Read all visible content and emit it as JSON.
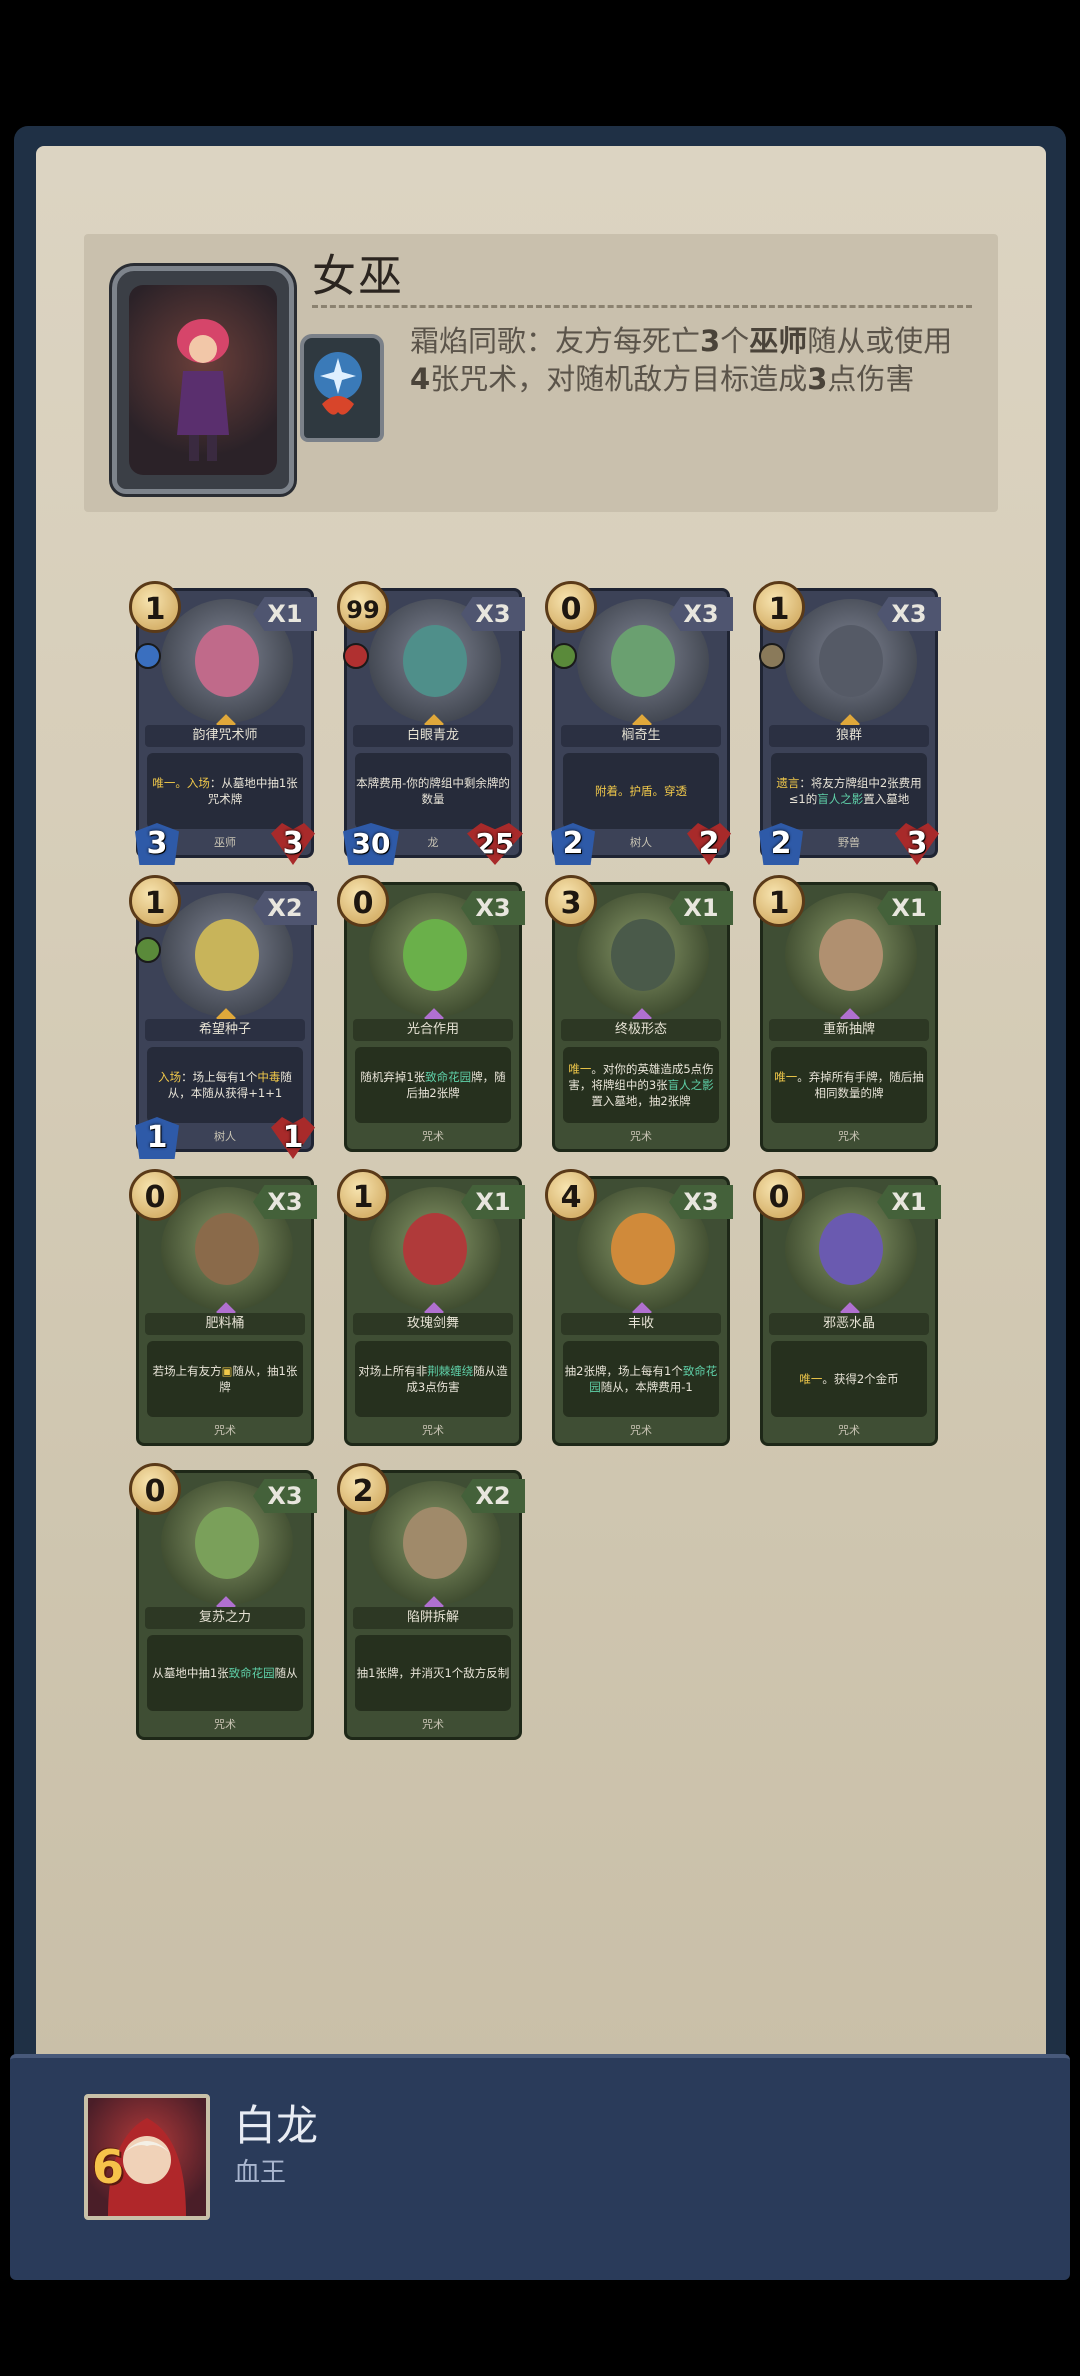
{
  "hero": {
    "name": "女巫",
    "skill_parts": [
      {
        "t": "霜焰同歌：友方每死亡",
        "b": false
      },
      {
        "t": "3",
        "b": true
      },
      {
        "t": "个",
        "b": false
      },
      {
        "t": "巫师",
        "b": true
      },
      {
        "t": "随从或使用",
        "b": false
      },
      {
        "t": "4",
        "b": true
      },
      {
        "t": "张咒术，对随机敌方目标造成",
        "b": false
      },
      {
        "t": "3",
        "b": true
      },
      {
        "t": "点伤害",
        "b": false
      }
    ]
  },
  "cards": [
    {
      "kind": "minion",
      "cost": "1",
      "count": "X1",
      "name": "韵律咒术师",
      "desc": [
        {
          "t": "唯一。",
          "c": "y"
        },
        {
          "t": "入场",
          "c": "y"
        },
        {
          "t": "：从墓地中抽1张咒术牌"
        }
      ],
      "race": "巫师",
      "atk": "3",
      "hp": "3",
      "tribe": "#3a6fbf"
    },
    {
      "kind": "minion",
      "cost": "99",
      "count": "X3",
      "name": "白眼青龙",
      "desc": [
        {
          "t": "本牌费用-你的牌组中剩余牌的数量"
        }
      ],
      "race": "龙",
      "atk": "30",
      "hp": "25",
      "tribe": "#b03030"
    },
    {
      "kind": "minion",
      "cost": "0",
      "count": "X3",
      "name": "榈奇生",
      "desc": [
        {
          "t": "附着。护盾。穿透",
          "c": "y"
        }
      ],
      "race": "树人",
      "atk": "2",
      "hp": "2",
      "tribe": "#5a8a3a"
    },
    {
      "kind": "minion",
      "cost": "1",
      "count": "X3",
      "name": "狼群",
      "desc": [
        {
          "t": "遗言",
          "c": "y"
        },
        {
          "t": "：将友方牌组中2张费用≤1的"
        },
        {
          "t": "盲人之影",
          "c": "g"
        },
        {
          "t": "置入墓地"
        }
      ],
      "race": "野兽",
      "atk": "2",
      "hp": "3",
      "tribe": "#8a7a5a"
    },
    {
      "kind": "minion",
      "cost": "1",
      "count": "X2",
      "name": "希望种子",
      "desc": [
        {
          "t": "入场",
          "c": "y"
        },
        {
          "t": "：场上每有1个"
        },
        {
          "t": "中毒",
          "c": "y"
        },
        {
          "t": "随从，本随从获得+1+1"
        }
      ],
      "race": "树人",
      "atk": "1",
      "hp": "1",
      "tribe": "#5a8a3a"
    },
    {
      "kind": "spell",
      "cost": "0",
      "count": "X3",
      "name": "光合作用",
      "desc": [
        {
          "t": "随机弃掉1张"
        },
        {
          "t": "致命花园",
          "c": "g"
        },
        {
          "t": "牌，随后抽2张牌"
        }
      ],
      "race": "咒术"
    },
    {
      "kind": "spell",
      "cost": "3",
      "count": "X1",
      "name": "终极形态",
      "desc": [
        {
          "t": "唯一",
          "c": "y"
        },
        {
          "t": "。对你的英雄造成5点伤害，将牌组中的3张"
        },
        {
          "t": "盲人之影",
          "c": "g"
        },
        {
          "t": "置入墓地，抽2张牌"
        }
      ],
      "race": "咒术"
    },
    {
      "kind": "spell",
      "cost": "1",
      "count": "X1",
      "name": "重新抽牌",
      "desc": [
        {
          "t": "唯一",
          "c": "y"
        },
        {
          "t": "。弃掉所有手牌，随后抽相同数量的牌"
        }
      ],
      "race": "咒术"
    },
    {
      "kind": "spell",
      "cost": "0",
      "count": "X3",
      "name": "肥料桶",
      "desc": [
        {
          "t": "若场上有友方"
        },
        {
          "t": "▣",
          "c": "y"
        },
        {
          "t": "随从，抽1张牌"
        }
      ],
      "race": "咒术"
    },
    {
      "kind": "spell",
      "cost": "1",
      "count": "X1",
      "name": "玫瑰剑舞",
      "desc": [
        {
          "t": "对场上所有非"
        },
        {
          "t": "荆棘缠绕",
          "c": "g"
        },
        {
          "t": "随从造成3点伤害"
        }
      ],
      "race": "咒术"
    },
    {
      "kind": "spell",
      "cost": "4",
      "count": "X3",
      "name": "丰收",
      "desc": [
        {
          "t": "抽2张牌，场上每有1个"
        },
        {
          "t": "致命花园",
          "c": "g"
        },
        {
          "t": "随从，本牌费用-1"
        }
      ],
      "race": "咒术"
    },
    {
      "kind": "spell",
      "cost": "0",
      "count": "X1",
      "name": "邪恶水晶",
      "desc": [
        {
          "t": "唯一",
          "c": "y"
        },
        {
          "t": "。获得2个金币"
        }
      ],
      "race": "咒术"
    },
    {
      "kind": "spell",
      "cost": "0",
      "count": "X3",
      "name": "复苏之力",
      "desc": [
        {
          "t": "从墓地中抽1张"
        },
        {
          "t": "致命花园",
          "c": "g"
        },
        {
          "t": "随从"
        }
      ],
      "race": "咒术"
    },
    {
      "kind": "spell",
      "cost": "2",
      "count": "X2",
      "name": "陷阱拆解",
      "desc": [
        {
          "t": "抽1张牌，并消灭1个敌方反制"
        }
      ],
      "race": "咒术"
    }
  ],
  "player": {
    "name": "白龙",
    "title": "血王",
    "level": "6"
  },
  "colors": {
    "parchment": "#d6cdb8",
    "minion_card": "#3c4257",
    "spell_card": "#3f4e34",
    "bottom_bar": "#2a3b5a"
  }
}
